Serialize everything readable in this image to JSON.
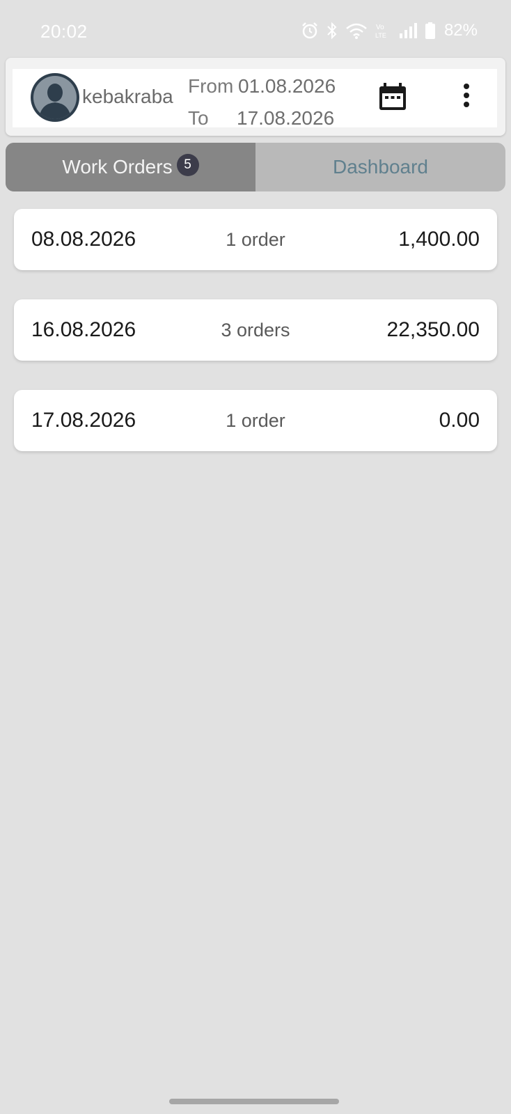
{
  "status_bar": {
    "time": "20:02",
    "battery": "82%",
    "icons": [
      "alarm-icon",
      "bluetooth-icon",
      "wifi-icon",
      "volte-icon",
      "signal-icon",
      "battery-icon"
    ]
  },
  "header": {
    "username": "kebakraba",
    "from_label": "From",
    "from_date": "01.08.2026",
    "to_label": "To",
    "to_date": "17.08.2026",
    "calendar_icon": "calendar-icon",
    "menu_icon": "more-vert-icon"
  },
  "tabs": [
    {
      "label": "Work Orders",
      "badge": "5",
      "active": true
    },
    {
      "label": "Dashboard",
      "active": false
    }
  ],
  "orders": [
    {
      "date": "08.08.2026",
      "count": "1 order",
      "amount": "1,400.00"
    },
    {
      "date": "16.08.2026",
      "count": "3 orders",
      "amount": "22,350.00"
    },
    {
      "date": "17.08.2026",
      "count": "1 order",
      "amount": "0.00"
    }
  ],
  "colors": {
    "background": "#e1e1e1",
    "tab_active": "#868686",
    "tab_inactive": "#b9b9b9",
    "dashboard_text": "#60808e",
    "badge": "#3c3c4a"
  }
}
